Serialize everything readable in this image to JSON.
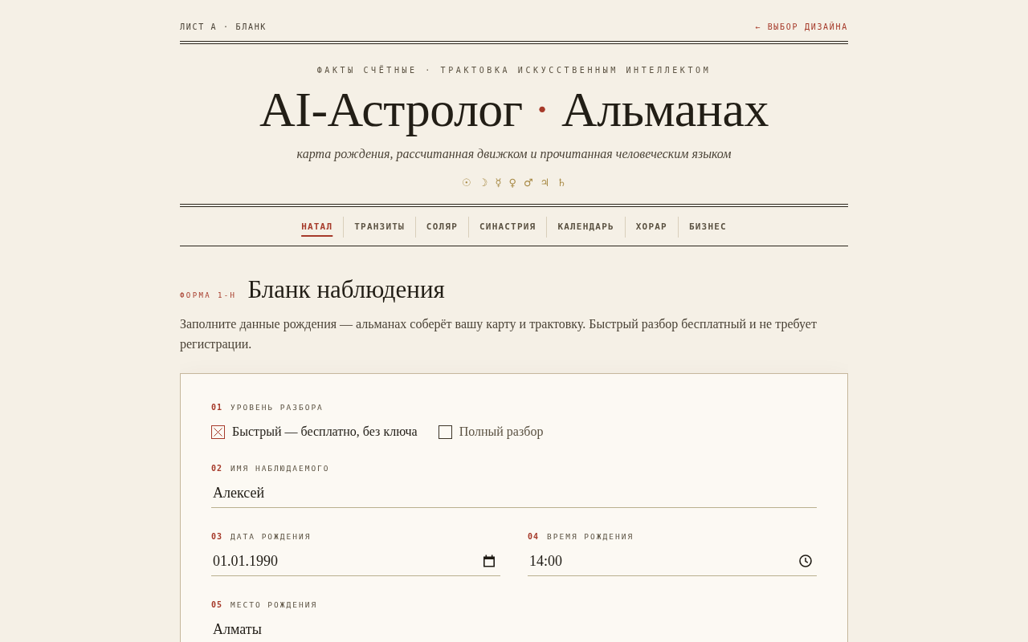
{
  "top_bar": {
    "sheet_label": "ЛИСТ А · БЛАНК",
    "back_link": "← ВЫБОР ДИЗАЙНА"
  },
  "masthead": {
    "kicker": "ФАКТЫ СЧЁТНЫЕ · ТРАКТОВКА ИСКУССТВЕННЫМ ИНТЕЛЛЕКТОМ",
    "title": {
      "first": "AI-Астролог",
      "separator": "·",
      "second": "Альманах"
    },
    "subtitle": "карта рождения, рассчитанная движком и прочитанная человеческим языком",
    "planet_symbols": [
      "☉",
      "☽",
      "☿",
      "♀",
      "♂",
      "♃",
      "♄"
    ]
  },
  "tabs": [
    {
      "label": "НАТАЛ",
      "selected": true
    },
    {
      "label": "ТРАНЗИТЫ",
      "selected": false
    },
    {
      "label": "СОЛЯР",
      "selected": false
    },
    {
      "label": "СИНАСТРИЯ",
      "selected": false
    },
    {
      "label": "КАЛЕНДАРЬ",
      "selected": false
    },
    {
      "label": "ХОРАР",
      "selected": false
    },
    {
      "label": "БИЗНЕС",
      "selected": false
    }
  ],
  "form": {
    "code": "ФОРМА 1-Н",
    "title": "Бланк наблюдения",
    "intro": "Заполните данные рождения — альманах соберёт вашу карту и трактовку. Быстрый разбор бесплатный и не требует регистрации.",
    "fields": [
      {
        "number": "01",
        "label": "УРОВЕНЬ РАЗБОРА",
        "kind": "choice",
        "options": [
          {
            "label": "Быстрый — бесплатно, без ключа",
            "selected": true
          },
          {
            "label": "Полный разбор",
            "selected": false
          }
        ]
      },
      {
        "number": "02",
        "label": "ИМЯ НАБЛЮДАЕМОГО",
        "kind": "text",
        "value": "Алексей"
      },
      {
        "number": "03",
        "label": "ДАТА РОЖДЕНИЯ",
        "kind": "date",
        "value": "01.01.1990"
      },
      {
        "number": "04",
        "label": "ВРЕМЯ РОЖДЕНИЯ",
        "kind": "time",
        "value": "14:00"
      },
      {
        "number": "05",
        "label": "МЕСТО РОЖДЕНИЯ",
        "kind": "text",
        "value": "Алматы"
      }
    ]
  }
}
